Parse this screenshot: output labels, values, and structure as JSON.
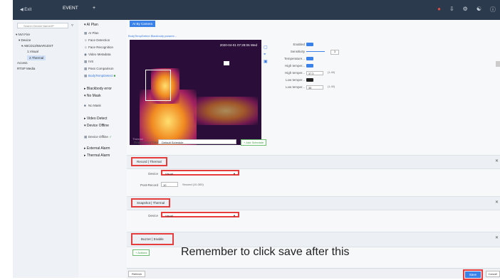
{
  "topbar": {
    "back_label": "Exit",
    "tab_label": "EVENT",
    "add_tab": "+"
  },
  "tree": {
    "search_placeholder": "Search Device Name/IP",
    "items": [
      "NVI Fire",
      "Device",
      "ABCD12/56AR1DST",
      "1.Visual",
      "2.Thermal",
      "Access",
      "RTSP Media"
    ]
  },
  "events": {
    "ai_plan": "AI Plan",
    "ai_items": [
      "AI Plan",
      "Face Detection",
      "Face Recognition",
      "Video Metadata",
      "IVS",
      "Pass Comparison",
      "BodyTempDetect"
    ],
    "blackbody": "Blackbody error",
    "no_mask_group": "No Mask",
    "no_mask_item": "No Mask",
    "video_detect": "Video Detect",
    "device_offline_group": "Device Offline",
    "device_offline_item": "Device Offline",
    "external_alarm": "External Alarm",
    "thermal_alarm": "Thermal Alarm"
  },
  "main": {
    "ai_tab": "AI By Camera",
    "breadcrumb": "BodyTempDetect   Blackbody parame...",
    "timestamp": "2020-04-01 07:28:06 Wed",
    "watermark": "Thermal",
    "props": [
      {
        "label": "Enabled",
        "type": "toggle",
        "on": true
      },
      {
        "label": "Sensitivity",
        "type": "slider",
        "value": "3"
      },
      {
        "label": "Temperature...",
        "type": "toggle",
        "on": true
      },
      {
        "label": "High temper...",
        "type": "toggle",
        "on": true
      },
      {
        "label": "High temper...",
        "type": "value",
        "value": "37.3",
        "range": "(1-40)"
      },
      {
        "label": "Low temper...",
        "type": "toggle",
        "on": false
      },
      {
        "label": "Low temper...",
        "type": "value",
        "value": "35",
        "range": "(1-40)"
      }
    ],
    "schedule_label": "Deployment Time",
    "schedule_value": "Default Schedule",
    "add_schedule": "+ Add Schedule",
    "record_title": "Record | Thermal",
    "record_device_label": "Device",
    "record_device_value": "Visual",
    "post_record_label": "Post-Record",
    "post_record_value": "10",
    "post_record_range": "Second (10-300)",
    "snapshot_title": "Snapshot | Thermal",
    "snapshot_device_label": "Device",
    "snapshot_device_value": "Visual",
    "buzzer_title": "Buzzer | Enable",
    "actions_button": "+ Actions",
    "note": "Remember to click save after this",
    "refresh": "Refresh",
    "save": "Save",
    "cancel": "Cancel"
  }
}
